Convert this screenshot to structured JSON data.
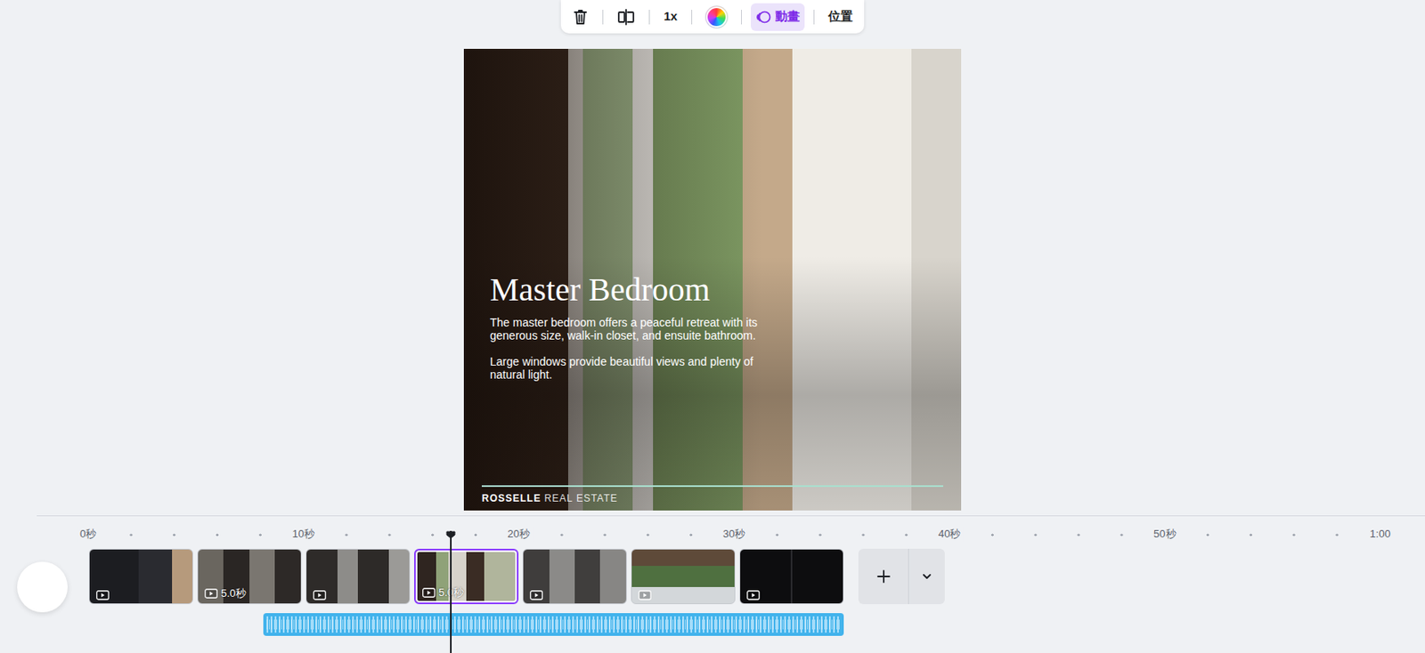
{
  "toolbar": {
    "speed": "1x",
    "tabs": [
      {
        "label": "動畫",
        "selected": true
      },
      {
        "label": "位置",
        "selected": false
      }
    ]
  },
  "canvas": {
    "title": "Master Bedroom",
    "paragraphs": [
      "The master bedroom offers a peaceful retreat with its generous size, walk-in closet, and ensuite bathroom.",
      "Large windows provide beautiful views and plenty of natural light."
    ],
    "brand": "ROSSELLE",
    "brand_suffix": "REAL ESTATE"
  },
  "ruler": {
    "ticks": [
      "0秒",
      "10秒",
      "20秒",
      "30秒",
      "40秒",
      "50秒",
      "1:00"
    ]
  },
  "playhead": {
    "level": 0.281
  },
  "clips": [
    {
      "selected": false
    },
    {
      "selected": false,
      "duration": "5.0秒"
    },
    {
      "selected": false
    },
    {
      "selected": true,
      "duration": "5.0秒"
    },
    {
      "selected": false
    },
    {
      "selected": false
    },
    {
      "selected": false
    }
  ]
}
